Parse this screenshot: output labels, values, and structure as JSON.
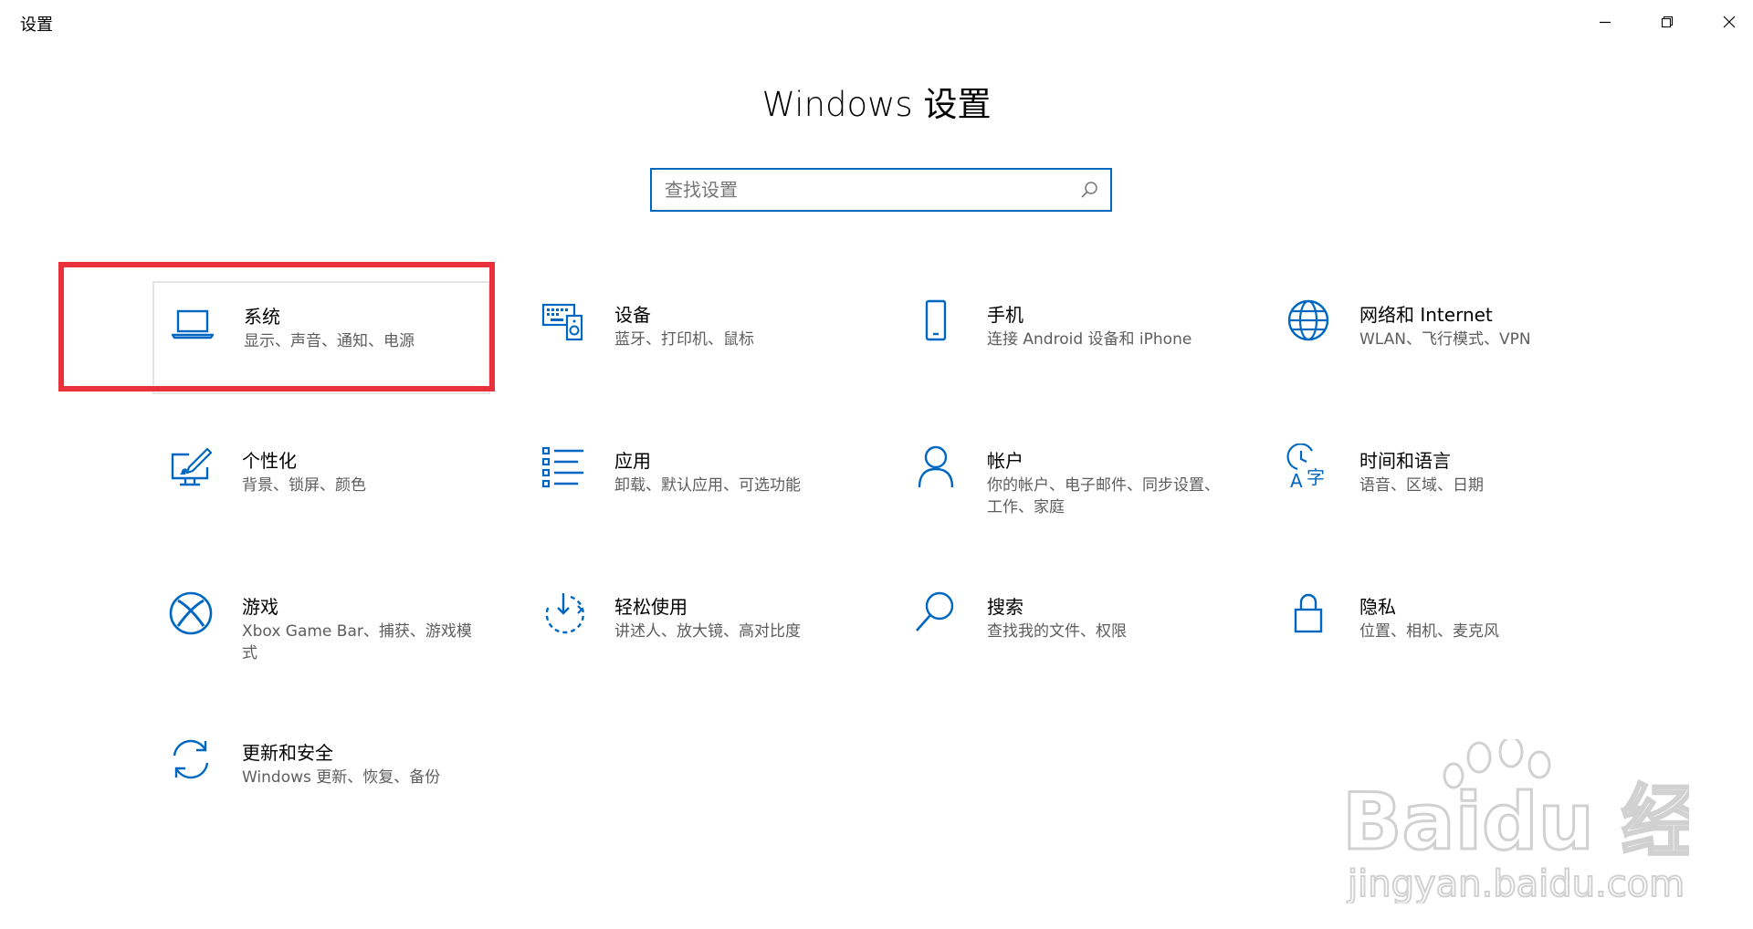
{
  "window": {
    "app_title": "设置",
    "controls": [
      "minimize",
      "maximize",
      "close"
    ]
  },
  "header": {
    "title": "Windows 设置"
  },
  "search": {
    "placeholder": "查找设置",
    "value": ""
  },
  "tiles": [
    {
      "title": "系统",
      "desc": "显示、声音、通知、电源",
      "icon": "laptop-icon"
    },
    {
      "title": "设备",
      "desc": "蓝牙、打印机、鼠标",
      "icon": "devices-icon"
    },
    {
      "title": "手机",
      "desc": "连接 Android 设备和 iPhone",
      "icon": "phone-icon"
    },
    {
      "title": "网络和 Internet",
      "desc": "WLAN、飞行模式、VPN",
      "icon": "globe-icon"
    },
    {
      "title": "个性化",
      "desc": "背景、锁屏、颜色",
      "icon": "personalization-icon"
    },
    {
      "title": "应用",
      "desc": "卸载、默认应用、可选功能",
      "icon": "apps-list-icon"
    },
    {
      "title": "帐户",
      "desc": "你的帐户、电子邮件、同步设置、工作、家庭",
      "icon": "person-icon"
    },
    {
      "title": "时间和语言",
      "desc": "语音、区域、日期",
      "icon": "time-language-icon"
    },
    {
      "title": "游戏",
      "desc": "Xbox Game Bar、捕获、游戏模式",
      "icon": "xbox-icon"
    },
    {
      "title": "轻松使用",
      "desc": "讲述人、放大镜、高对比度",
      "icon": "ease-of-access-icon"
    },
    {
      "title": "搜索",
      "desc": "查找我的文件、权限",
      "icon": "search-magnifier-icon"
    },
    {
      "title": "隐私",
      "desc": "位置、相机、麦克风",
      "icon": "lock-icon"
    },
    {
      "title": "更新和安全",
      "desc": "Windows 更新、恢复、备份",
      "icon": "update-sync-icon"
    }
  ],
  "colors": {
    "accent": "#0067c0",
    "highlight": "#e8313a",
    "desc_text": "#5d5d5d"
  },
  "watermark": {
    "brand": "Baidu 经验",
    "url": "jingyan.baidu.com"
  }
}
